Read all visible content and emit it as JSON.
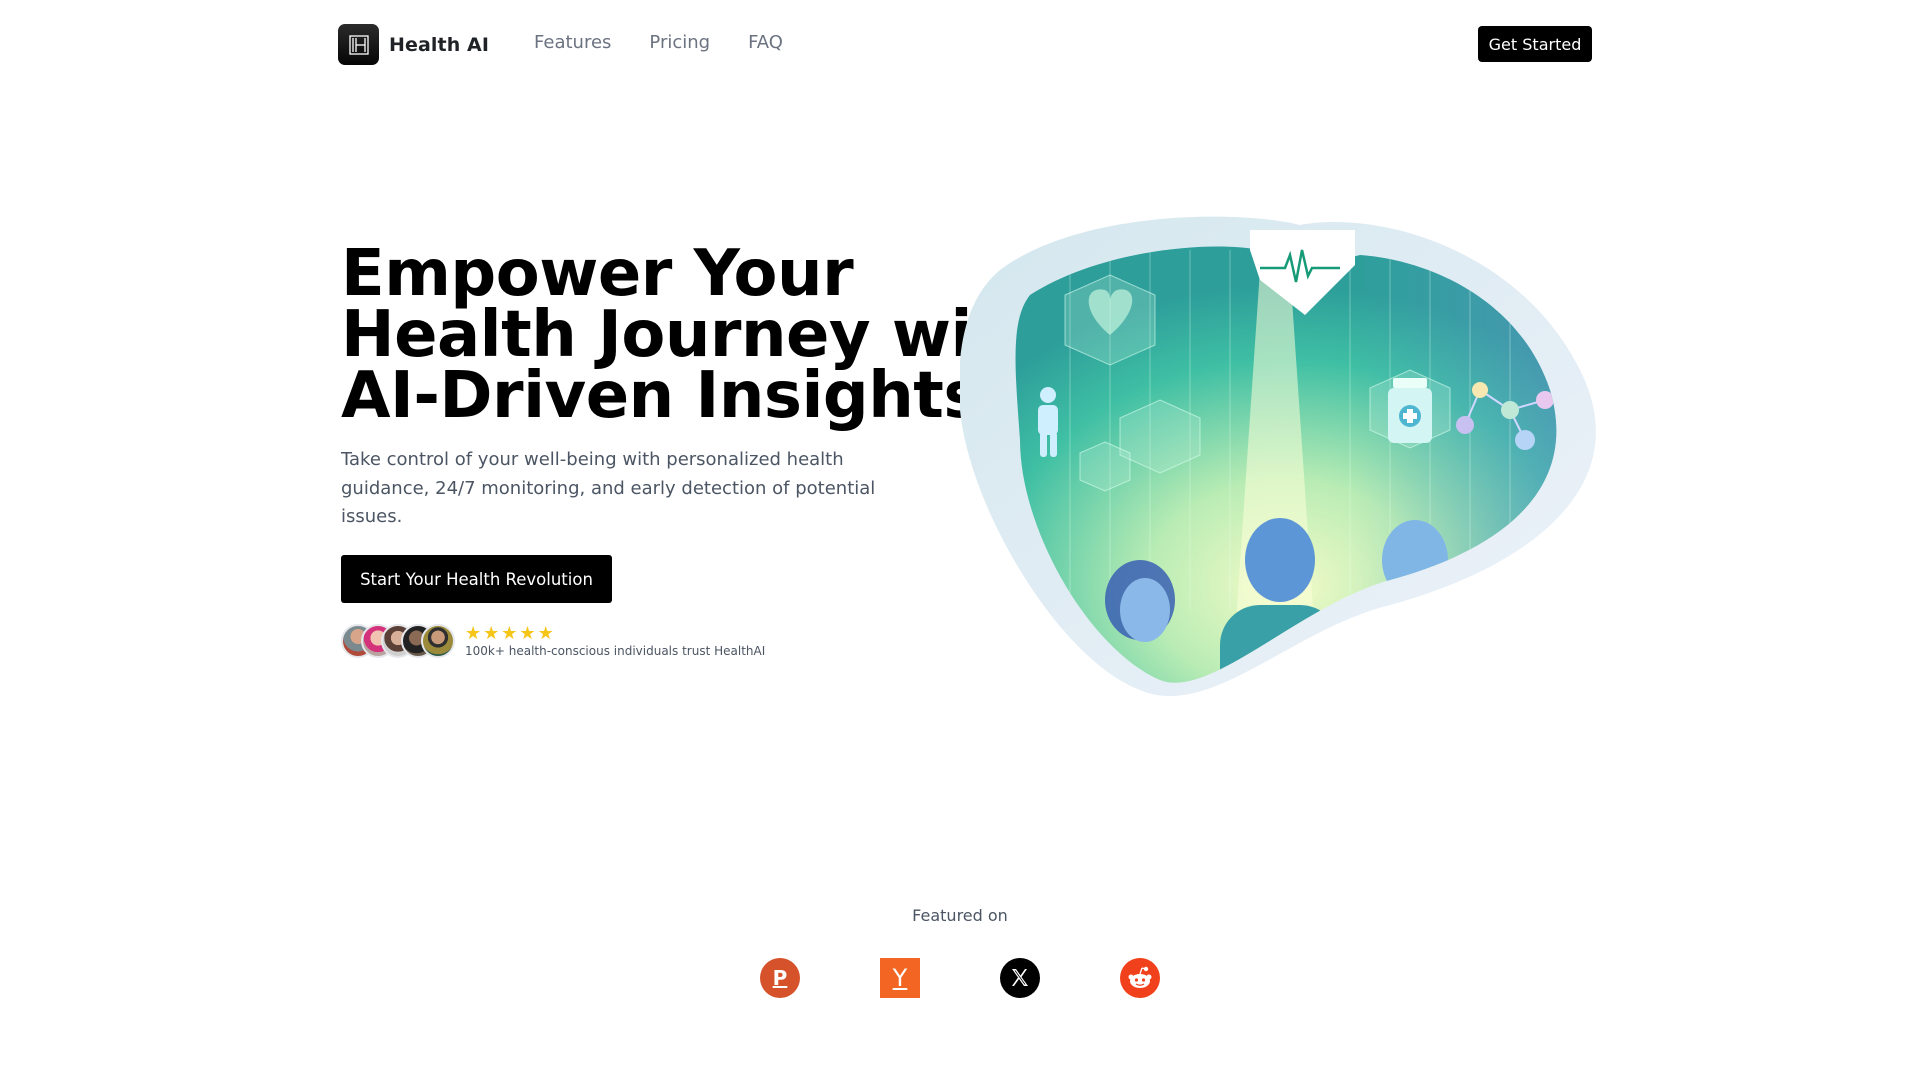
{
  "header": {
    "brand": "Health AI",
    "nav": [
      {
        "label": "Features"
      },
      {
        "label": "Pricing"
      },
      {
        "label": "FAQ"
      }
    ],
    "cta_label": "Get Started"
  },
  "hero": {
    "title_lines": [
      "Empower Your",
      "Health Journey with",
      "AI-Driven Insights"
    ],
    "subtitle": "Take control of your well-being with personalized health guidance, 24/7 monitoring, and early detection of potential issues.",
    "cta_label": "Start Your Health Revolution",
    "rating": {
      "stars": 5,
      "out_of": 5
    },
    "trust_text": "100k+ health-conscious individuals trust HealthAI",
    "avatar_count": 5,
    "image_alt": "Illustration of people surrounded by AI health icons: heart, human figure, medicine bottle, molecules and heartbeat line"
  },
  "featured": {
    "label": "Featured on",
    "logos": [
      {
        "name": "Product Hunt",
        "glyph": "P",
        "color": "#d5522b"
      },
      {
        "name": "Y Combinator",
        "glyph": "Y",
        "color": "#f26522"
      },
      {
        "name": "X",
        "glyph": "X",
        "color": "#000000"
      },
      {
        "name": "Reddit",
        "glyph": "reddit",
        "color": "#f1411c"
      }
    ]
  },
  "colors": {
    "primary": "#000000",
    "text_muted": "#4b5563",
    "nav_text": "#6b7280",
    "star": "#f5c518"
  }
}
